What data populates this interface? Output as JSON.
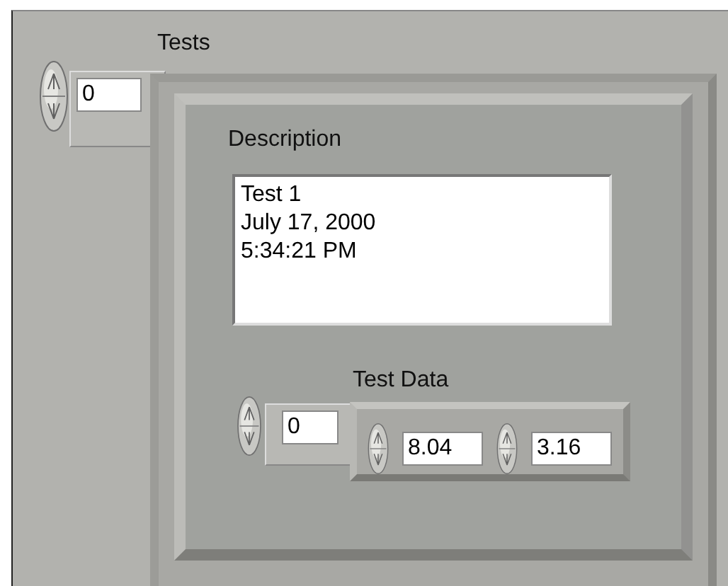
{
  "tests": {
    "label": "Tests",
    "index": "0",
    "element": {
      "description": {
        "label": "Description",
        "value": "Test 1\nJuly 17, 2000\n5:34:21 PM"
      },
      "test_data": {
        "label": "Test Data",
        "index": "0",
        "values": [
          "8.04",
          "3.16"
        ]
      }
    }
  }
}
